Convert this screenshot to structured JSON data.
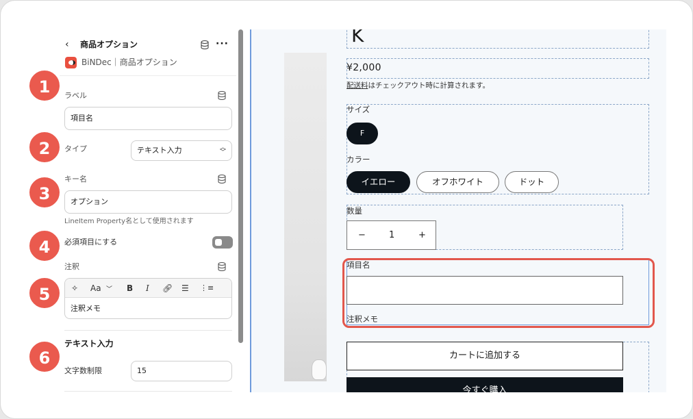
{
  "panel": {
    "back_icon": "‹",
    "title": "商品オプション",
    "more_icon": "···",
    "app_name": "BiNDec｜商品オプション",
    "label_field": {
      "label": "ラベル",
      "value": "項目名"
    },
    "type_field": {
      "label": "タイプ",
      "value": "テキスト入力"
    },
    "key_field": {
      "label": "キー名",
      "value": "オプション",
      "hint": "LineItem Property名として使用されます"
    },
    "required": {
      "label": "必須項目にする",
      "on": false
    },
    "note_field": {
      "label": "注釈",
      "value": "注釈メモ",
      "toolbar": [
        "magic-icon",
        "Aa",
        "B",
        "I",
        "link-icon",
        "bullet-list-icon",
        "numbered-list-icon"
      ]
    },
    "text_input_section": {
      "title": "テキスト入力",
      "char_limit_label": "文字数制限",
      "char_limit_value": "15"
    }
  },
  "badges": [
    "1",
    "2",
    "3",
    "4",
    "5",
    "6"
  ],
  "preview": {
    "title_glyph": "K",
    "price": "¥2,000",
    "shipping_link": "配送料",
    "shipping_rest": "はチェックアウト時に計算されます。",
    "size_label": "サイズ",
    "sizes": [
      "F"
    ],
    "color_label": "カラー",
    "colors": [
      "イエロー",
      "オフホワイト",
      "ドット"
    ],
    "selected_color": "イエロー",
    "qty_label": "数量",
    "qty": {
      "minus": "−",
      "value": "1",
      "plus": "+"
    },
    "custom_label": "項目名",
    "custom_note": "注釈メモ",
    "add_to_cart": "カートに追加する",
    "buy_now": "今すぐ購入"
  },
  "colors": {
    "badge": "#ea5a4e",
    "highlight": "#e2574c",
    "dark_button": "#0d141b",
    "preview_border": "#6f9bdc"
  }
}
